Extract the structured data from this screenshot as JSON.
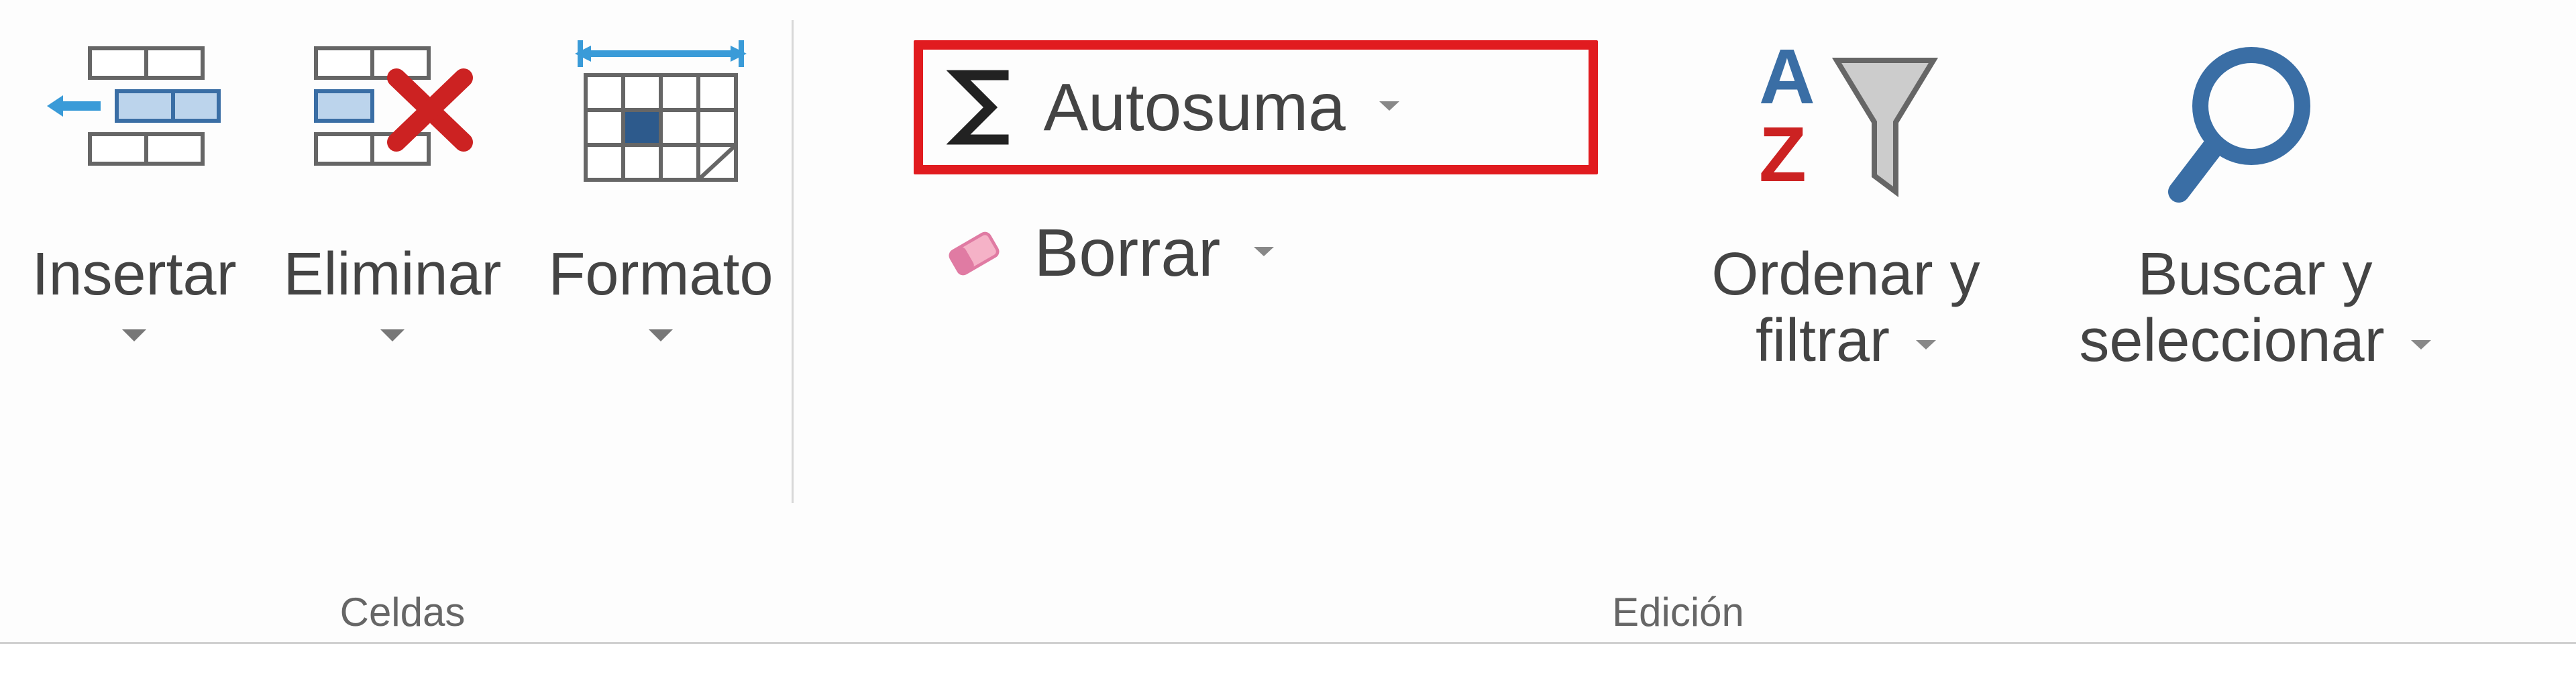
{
  "celdas": {
    "group_label": "Celdas",
    "insertar": "Insertar",
    "eliminar": "Eliminar",
    "formato": "Formato"
  },
  "edicion": {
    "group_label": "Edición",
    "autosuma": "Autosuma",
    "borrar": "Borrar",
    "ordenar_line1": "Ordenar y",
    "ordenar_line2": "filtrar",
    "buscar_line1": "Buscar y",
    "buscar_line2": "seleccionar"
  },
  "colors": {
    "highlight": "#e11b1f",
    "accent_blue": "#3a6ea5"
  }
}
